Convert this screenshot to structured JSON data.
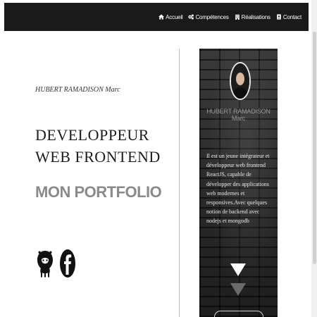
{
  "nav": {
    "items": [
      {
        "label": "Accueil",
        "icon": "home-icon"
      },
      {
        "label": "Compétences",
        "icon": "gears-icon"
      },
      {
        "label": "Réalisations",
        "icon": "building-icon"
      },
      {
        "label": "Contact",
        "icon": "address-book-icon"
      }
    ]
  },
  "hero": {
    "author": "HUBERT RAMADISON Marc",
    "headline": "DEVELOPPEUR WEB FRONTEND",
    "portfolio": "MON PORTFOLIO",
    "social": [
      {
        "name": "github-icon"
      },
      {
        "name": "facebook-icon"
      }
    ]
  },
  "card": {
    "name": "HUBERT RAMADISON Marc",
    "bio": "Il est un jeune intégrateur et développeur web frontend ReactJS, capable de développer des applications web modernes et responsives.Avec quelques notion de backend avec nodejs et mongodb",
    "arrows": [
      "triangle-down-icon",
      "triangle-down-icon"
    ]
  },
  "colors": {
    "navbar": "#1a1a1a",
    "portfolio": "#8a8a8a",
    "card_bg": "#2a2a2a"
  }
}
